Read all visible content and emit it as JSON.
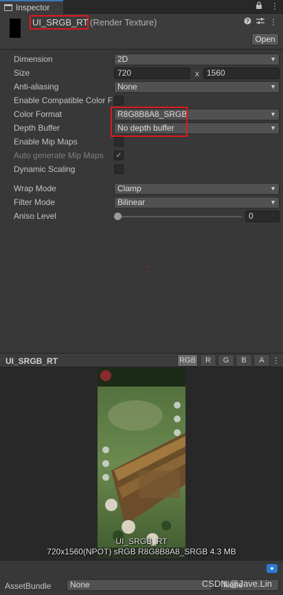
{
  "window": {
    "tab_title": "Inspector",
    "tab_icons": [
      "lock-icon",
      "kebab-menu-icon"
    ]
  },
  "header": {
    "asset_name": "UI_SRGB_RT",
    "asset_type": "(Render Texture)",
    "open_button": "Open",
    "icons": [
      "help-icon",
      "presets-icon",
      "kebab-menu-icon"
    ]
  },
  "properties": {
    "dimension": {
      "label": "Dimension",
      "value": "2D"
    },
    "size": {
      "label": "Size",
      "width": "720",
      "separator": "x",
      "height": "1560"
    },
    "anti_aliasing": {
      "label": "Anti-aliasing",
      "value": "None"
    },
    "enable_compatible_color_format": {
      "label": "Enable Compatible Color F",
      "checked": false
    },
    "color_format": {
      "label": "Color Format",
      "value": "R8G8B8A8_SRGB"
    },
    "depth_buffer": {
      "label": "Depth Buffer",
      "value": "No depth buffer"
    },
    "enable_mip_maps": {
      "label": "Enable Mip Maps",
      "checked": false
    },
    "auto_generate_mip_maps": {
      "label": "Auto generate Mip Maps",
      "checked": true,
      "disabled": true,
      "check_glyph": "✓"
    },
    "dynamic_scaling": {
      "label": "Dynamic Scaling",
      "checked": false
    },
    "wrap_mode": {
      "label": "Wrap Mode",
      "value": "Clamp"
    },
    "filter_mode": {
      "label": "Filter Mode",
      "value": "Bilinear"
    },
    "aniso_level": {
      "label": "Aniso Level",
      "value": "0",
      "slider_fraction": 0
    }
  },
  "preview": {
    "title": "UI_SRGB_RT",
    "channels": [
      "RGB",
      "R",
      "G",
      "B",
      "A"
    ],
    "active_channel": "RGB",
    "caption_name": "UI_SRGB_RT",
    "caption_info": "720x1560(NPOT) sRGB  R8G8B8A8_SRGB  4.3 MB"
  },
  "footer": {
    "asset_bundle_label": "AssetBundle",
    "asset_bundle_value": "None",
    "variant_value": "None",
    "watermark": "CSDN @Jave.Lin"
  },
  "colors": {
    "background": "#383838",
    "highlight_box": "#e0191d",
    "tag_icon": "#2c7bd3"
  }
}
